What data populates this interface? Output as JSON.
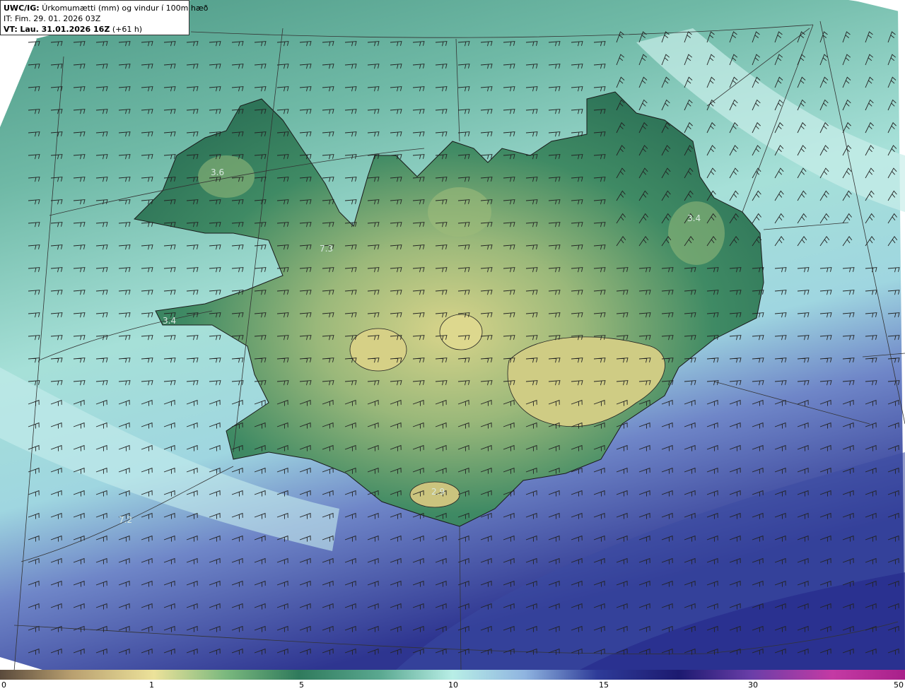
{
  "header": {
    "model": "UWC/IG:",
    "title": "Úrkomumætti (mm) og vindur í 100m hæð",
    "init_label": "IT:",
    "init_time": "Fim. 29. 01. 2026 03Z",
    "valid_label": "VT:",
    "valid_time": "Lau. 31.01.2026 16Z",
    "lead": "(+61 h)"
  },
  "map_labels": [
    {
      "text": "3.6"
    },
    {
      "text": "3.4"
    },
    {
      "text": "7.3"
    },
    {
      "text": "3.4"
    },
    {
      "text": "2.9"
    },
    {
      "text": "7.2"
    }
  ],
  "colors": {
    "brown": "#6b5a4a",
    "yellow": "#e6dc8c",
    "green": "#2f7a5c",
    "cyan": "#a8e4de",
    "blue": "#2f3f96",
    "navy": "#1f1f78",
    "magenta": "#c03aa0"
  },
  "colorbar": {
    "ticks": [
      {
        "label": "0",
        "value": 0
      },
      {
        "label": "1",
        "value": 1
      },
      {
        "label": "5",
        "value": 5
      },
      {
        "label": "10",
        "value": 10
      },
      {
        "label": "15",
        "value": 15
      },
      {
        "label": "30",
        "value": 30
      },
      {
        "label": "50",
        "value": 50
      }
    ]
  }
}
